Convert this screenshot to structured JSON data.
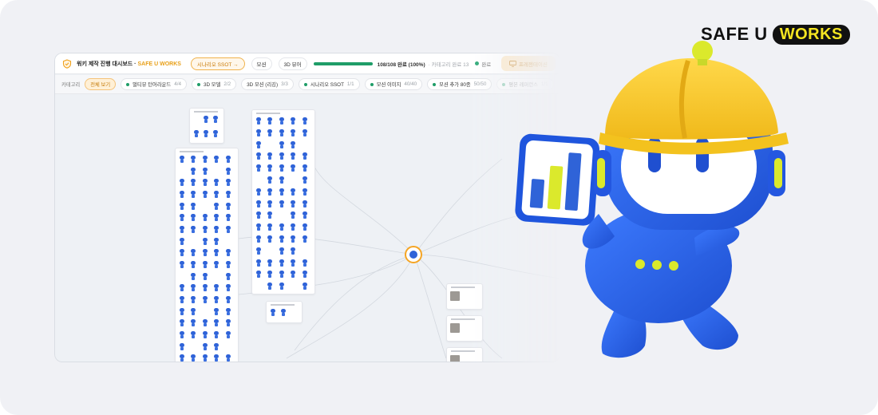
{
  "brand": {
    "left": "SAFE U",
    "right": "WORKS"
  },
  "topbar": {
    "title_prefix": "워키 제작 진행 대시보드 · ",
    "title_brand": "SAFE U WORKS",
    "scenario_pill": "시나리오 SSOT →",
    "motion": "모션",
    "viewer": "3D 뷰어",
    "progress_fraction": 1.0,
    "progress_count": "108/108 완료 (100%)",
    "progress_note": "· 카테고리 완료 13",
    "done_label": "완료",
    "present_button": "프레젠테이션"
  },
  "categories": {
    "label": "카테고리",
    "items": [
      {
        "label": "전체 보기",
        "count": "",
        "active": true
      },
      {
        "label": "멀티뷰 턴어라운드",
        "count": "4/4"
      },
      {
        "label": "3D 모델",
        "count": "2/2"
      },
      {
        "label": "3D 모션 (리깅)",
        "count": "3/3"
      },
      {
        "label": "시나리오 SSOT",
        "count": "1/1"
      },
      {
        "label": "모션 이미지",
        "count": "40/40"
      },
      {
        "label": "모션 추가 80종",
        "count": "50/50"
      },
      {
        "label": "평본 레퍼런스",
        "count": "1/1",
        "faded": true
      }
    ]
  },
  "icons": {
    "shield": "shield-icon",
    "monitor": "monitor-icon",
    "hub": "mascot-hub-icon",
    "mascot": "mascot-illustration"
  },
  "colors": {
    "accent_orange": "#f0a21e",
    "progress_green": "#1f9d68",
    "mascot_blue": "#2f63d8",
    "helmet_yellow": "#f6c623",
    "brand_yellow": "#f4e521"
  }
}
